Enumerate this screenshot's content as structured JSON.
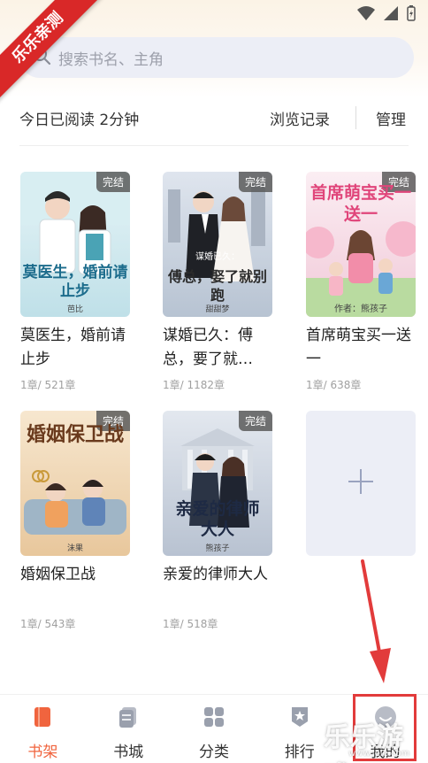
{
  "watermark_ribbon": "乐乐亲测",
  "search": {
    "placeholder": "搜索书名、主角"
  },
  "reading": {
    "today": "今日已阅读 2分钟",
    "history": "浏览记录",
    "manage": "管理"
  },
  "books": [
    {
      "title": "莫医生，婚前请止步",
      "cover_title": "莫医生，婚前请止步",
      "cover_author": "芭比",
      "badge": "完结",
      "progress": "1章/ 521章",
      "cover_bg": "#cfe8ee"
    },
    {
      "title": "谋婚已久：傅总，要了就…",
      "cover_title": "傅总，娶了就别跑",
      "cover_subtitle": "谋婚已久：",
      "cover_author": "甜甜梦",
      "badge": "完结",
      "progress": "1章/ 1182章",
      "cover_bg": "#c9d3df"
    },
    {
      "title": "首席萌宝买一送一",
      "cover_title": "首席萌宝买一送一",
      "cover_author": "作者：熊孩子",
      "badge": "完结",
      "progress": "1章/ 638章",
      "cover_bg": "#f6dbe5"
    },
    {
      "title": "婚姻保卫战",
      "cover_title": "婚姻保卫战",
      "cover_author": "沫果",
      "badge": "完结",
      "progress": "1章/ 543章",
      "cover_bg": "#f0dcc0"
    },
    {
      "title": "亲爱的律师大人",
      "cover_title": "亲爱的律师大人",
      "cover_author": "熊孩子",
      "badge": "完结",
      "progress": "1章/ 518章",
      "cover_bg": "#c9d2de"
    }
  ],
  "tabs": [
    {
      "label": "书架",
      "icon": "bookshelf-icon",
      "active": true
    },
    {
      "label": "书城",
      "icon": "bookstore-icon",
      "active": false
    },
    {
      "label": "分类",
      "icon": "category-icon",
      "active": false
    },
    {
      "label": "排行",
      "icon": "ranking-icon",
      "active": false
    },
    {
      "label": "我的",
      "icon": "profile-icon",
      "active": false
    }
  ],
  "watermark": {
    "text": "乐乐游戏",
    "url": "www.lele.com"
  },
  "colors": {
    "accent": "#f0643e",
    "annotation": "#e23b3b"
  }
}
